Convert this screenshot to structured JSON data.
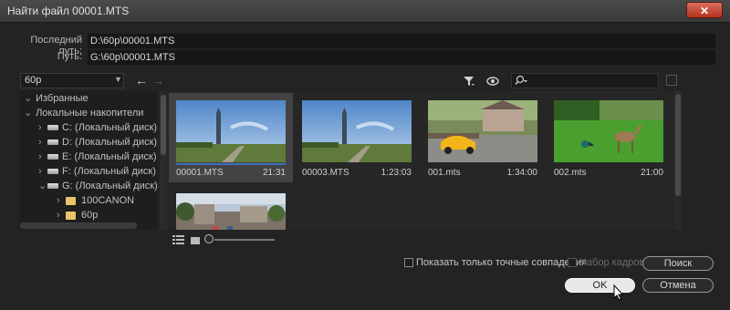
{
  "window": {
    "title": "Найти файл 00001.MTS",
    "close_symbol": "✕"
  },
  "paths": {
    "last_path_label": "Последний путь:",
    "last_path_value": "D:\\60p\\00001.MTS",
    "path_label": "Путь:",
    "path_value": "G:\\60p\\00001.MTS"
  },
  "toolbar": {
    "location": "60p",
    "back": "←",
    "forward": "→"
  },
  "tree": {
    "items": [
      {
        "label": "Избранные",
        "arrow": "v",
        "type": "section"
      },
      {
        "label": "Локальные накопители",
        "arrow": "v",
        "type": "section"
      },
      {
        "label": "C: (Локальный диск)",
        "arrow": ">",
        "type": "drive"
      },
      {
        "label": "D: (Локальный диск)",
        "arrow": ">",
        "type": "drive"
      },
      {
        "label": "E: (Локальный диск)",
        "arrow": ">",
        "type": "drive"
      },
      {
        "label": "F: (Локальный диск)",
        "arrow": ">",
        "type": "drive"
      },
      {
        "label": "G: (Локальный диск)",
        "arrow": "v",
        "type": "drive"
      },
      {
        "label": "100CANON",
        "arrow": ">",
        "type": "folder"
      },
      {
        "label": "60p",
        "arrow": ">",
        "type": "folder"
      }
    ]
  },
  "files": [
    {
      "name": "00001.MTS",
      "duration": "21:31",
      "selected": true,
      "progress": 1.0,
      "scene": "tower"
    },
    {
      "name": "00003.MTS",
      "duration": "1:23:03",
      "selected": false,
      "scene": "tower"
    },
    {
      "name": "001.mts",
      "duration": "1:34:00",
      "selected": false,
      "scene": "car"
    },
    {
      "name": "002.mts",
      "duration": "21:00",
      "selected": false,
      "scene": "deer"
    },
    {
      "name": "",
      "duration": "",
      "selected": false,
      "scene": "street"
    }
  ],
  "options": {
    "exact_match_label": "Показать только точные совпадения",
    "exact_match_checked": false,
    "frame_set_label": "Набор кадров",
    "frame_set_enabled": false
  },
  "buttons": {
    "search": "Поиск",
    "ok": "OK",
    "cancel": "Отмена"
  },
  "colors": {
    "accent": "#3a6fc0",
    "close": "#c8412b"
  }
}
